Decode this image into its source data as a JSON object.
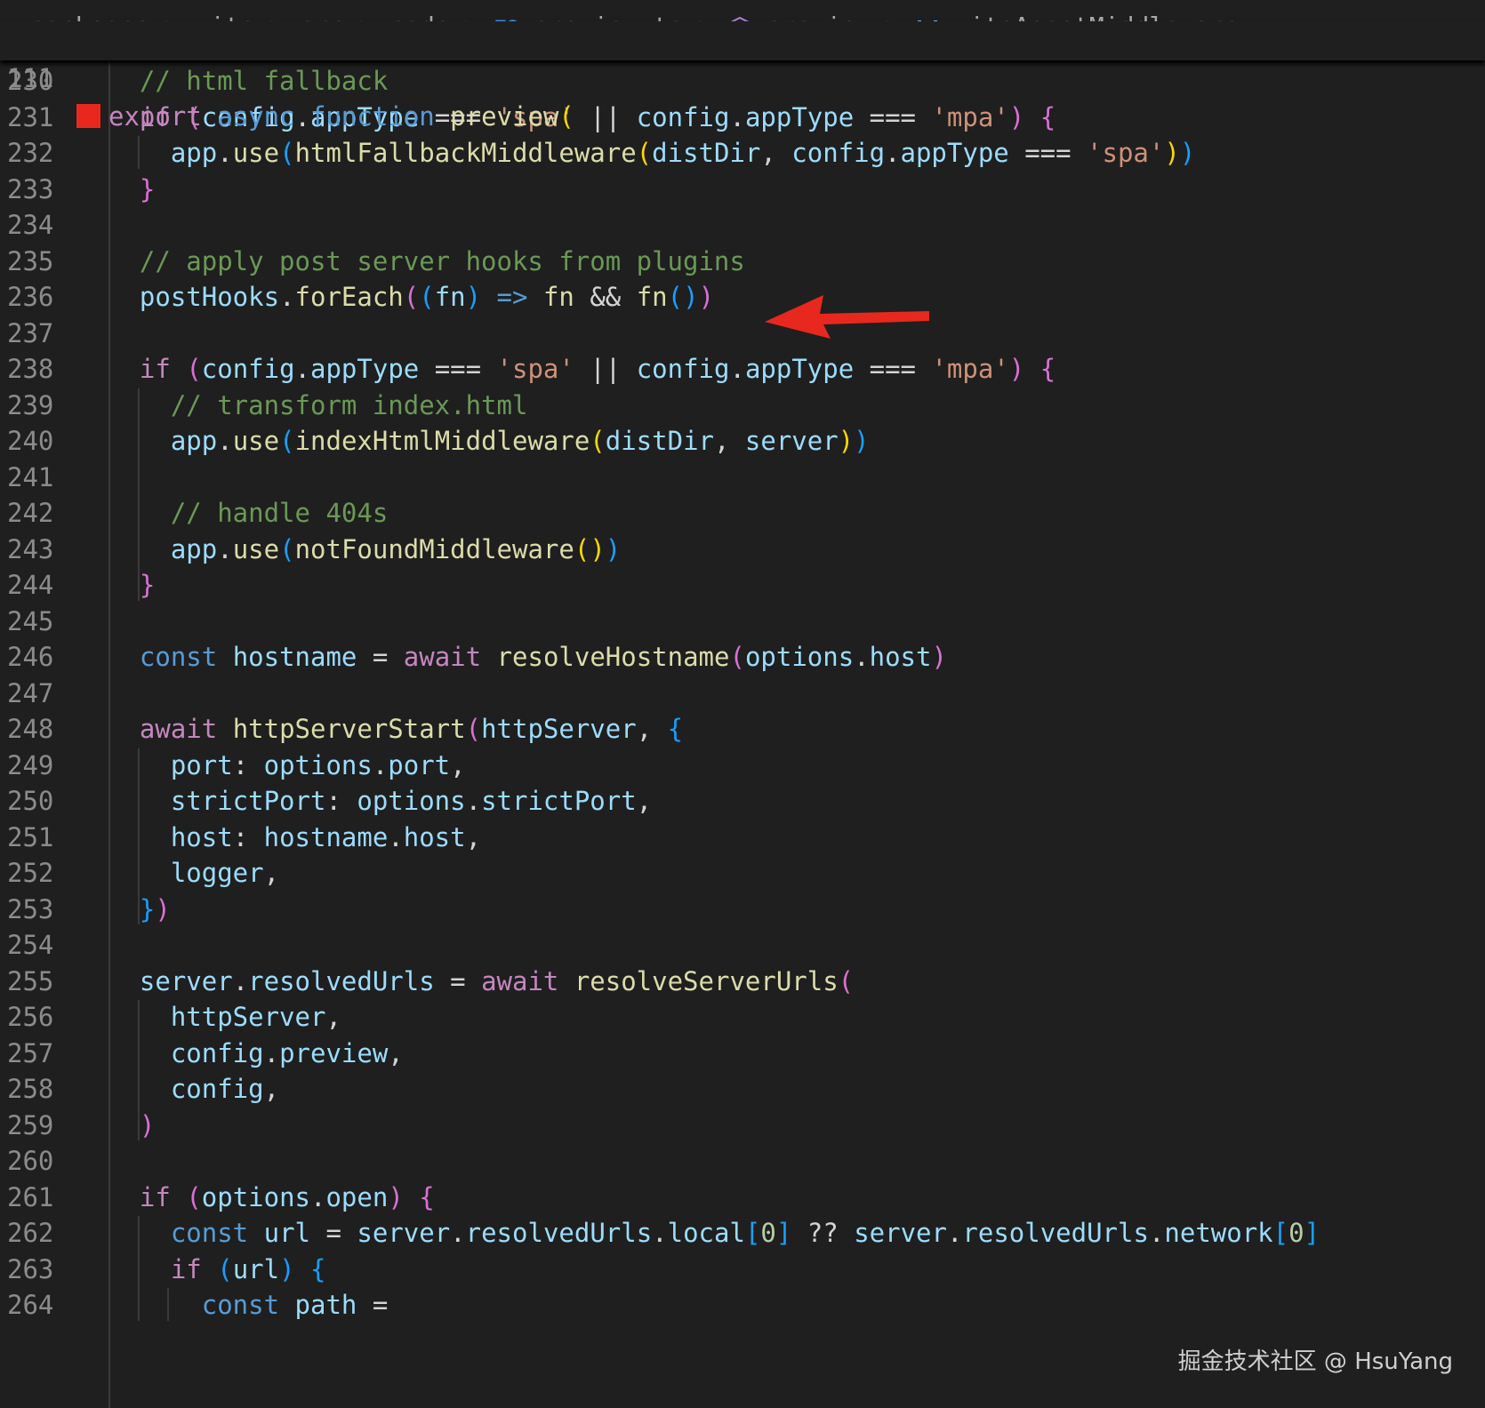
{
  "breadcrumb": {
    "items": [
      "packages",
      "vite",
      "src",
      "node",
      "preview.ts",
      "preview",
      "viteAssetMiddleware"
    ],
    "file_badge": "TS",
    "separator": ">"
  },
  "sticky_header": {
    "line_number": "111",
    "tokens": [
      {
        "t": "export",
        "c": "c-kw"
      },
      {
        "t": " "
      },
      {
        "t": "async",
        "c": "c-blue"
      },
      {
        "t": " "
      },
      {
        "t": "function",
        "c": "c-blue"
      },
      {
        "t": " "
      },
      {
        "t": "preview",
        "c": "c-fn"
      },
      {
        "t": "(",
        "c": "b1"
      }
    ],
    "stop_indicator_color": "#e8281e"
  },
  "code_lines": [
    {
      "n": "230",
      "tokens": [
        {
          "t": "  "
        },
        {
          "t": "// html fallback",
          "c": "c-com"
        }
      ]
    },
    {
      "n": "231",
      "tokens": [
        {
          "t": "  "
        },
        {
          "t": "if",
          "c": "c-kw"
        },
        {
          "t": " "
        },
        {
          "t": "(",
          "c": "b2"
        },
        {
          "t": "config",
          "c": "c-var"
        },
        {
          "t": "."
        },
        {
          "t": "appType",
          "c": "c-var"
        },
        {
          "t": " === "
        },
        {
          "t": "'spa'",
          "c": "c-str"
        },
        {
          "t": " || "
        },
        {
          "t": "config",
          "c": "c-var"
        },
        {
          "t": "."
        },
        {
          "t": "appType",
          "c": "c-var"
        },
        {
          "t": " === "
        },
        {
          "t": "'mpa'",
          "c": "c-str"
        },
        {
          "t": ")",
          "c": "b2"
        },
        {
          "t": " "
        },
        {
          "t": "{",
          "c": "b2"
        }
      ]
    },
    {
      "n": "232",
      "tokens": [
        {
          "t": "    "
        },
        {
          "t": "app",
          "c": "c-var"
        },
        {
          "t": "."
        },
        {
          "t": "use",
          "c": "c-fn"
        },
        {
          "t": "(",
          "c": "b3"
        },
        {
          "t": "htmlFallbackMiddleware",
          "c": "c-fn"
        },
        {
          "t": "(",
          "c": "b1"
        },
        {
          "t": "distDir",
          "c": "c-var"
        },
        {
          "t": ", "
        },
        {
          "t": "config",
          "c": "c-var"
        },
        {
          "t": "."
        },
        {
          "t": "appType",
          "c": "c-var"
        },
        {
          "t": " === "
        },
        {
          "t": "'spa'",
          "c": "c-str"
        },
        {
          "t": ")",
          "c": "b1"
        },
        {
          "t": ")",
          "c": "b3"
        }
      ]
    },
    {
      "n": "233",
      "tokens": [
        {
          "t": "  "
        },
        {
          "t": "}",
          "c": "b2"
        }
      ]
    },
    {
      "n": "234",
      "tokens": []
    },
    {
      "n": "235",
      "tokens": [
        {
          "t": "  "
        },
        {
          "t": "// apply post server hooks from plugins",
          "c": "c-com"
        }
      ]
    },
    {
      "n": "236",
      "tokens": [
        {
          "t": "  "
        },
        {
          "t": "postHooks",
          "c": "c-var"
        },
        {
          "t": "."
        },
        {
          "t": "forEach",
          "c": "c-fn"
        },
        {
          "t": "(",
          "c": "b2"
        },
        {
          "t": "(",
          "c": "b3"
        },
        {
          "t": "fn",
          "c": "c-var"
        },
        {
          "t": ")",
          "c": "b3"
        },
        {
          "t": " "
        },
        {
          "t": "=>",
          "c": "c-blue"
        },
        {
          "t": " "
        },
        {
          "t": "fn",
          "c": "c-fn"
        },
        {
          "t": " && "
        },
        {
          "t": "fn",
          "c": "c-fn"
        },
        {
          "t": "(",
          "c": "b3"
        },
        {
          "t": ")",
          "c": "b3"
        },
        {
          "t": ")",
          "c": "b2"
        }
      ]
    },
    {
      "n": "237",
      "tokens": []
    },
    {
      "n": "238",
      "tokens": [
        {
          "t": "  "
        },
        {
          "t": "if",
          "c": "c-kw"
        },
        {
          "t": " "
        },
        {
          "t": "(",
          "c": "b2"
        },
        {
          "t": "config",
          "c": "c-var"
        },
        {
          "t": "."
        },
        {
          "t": "appType",
          "c": "c-var"
        },
        {
          "t": " === "
        },
        {
          "t": "'spa'",
          "c": "c-str"
        },
        {
          "t": " || "
        },
        {
          "t": "config",
          "c": "c-var"
        },
        {
          "t": "."
        },
        {
          "t": "appType",
          "c": "c-var"
        },
        {
          "t": " === "
        },
        {
          "t": "'mpa'",
          "c": "c-str"
        },
        {
          "t": ")",
          "c": "b2"
        },
        {
          "t": " "
        },
        {
          "t": "{",
          "c": "b2"
        }
      ]
    },
    {
      "n": "239",
      "tokens": [
        {
          "t": "    "
        },
        {
          "t": "// transform index.html",
          "c": "c-com"
        }
      ]
    },
    {
      "n": "240",
      "tokens": [
        {
          "t": "    "
        },
        {
          "t": "app",
          "c": "c-var"
        },
        {
          "t": "."
        },
        {
          "t": "use",
          "c": "c-fn"
        },
        {
          "t": "(",
          "c": "b3"
        },
        {
          "t": "indexHtmlMiddleware",
          "c": "c-fn"
        },
        {
          "t": "(",
          "c": "b1"
        },
        {
          "t": "distDir",
          "c": "c-var"
        },
        {
          "t": ", "
        },
        {
          "t": "server",
          "c": "c-var"
        },
        {
          "t": ")",
          "c": "b1"
        },
        {
          "t": ")",
          "c": "b3"
        }
      ]
    },
    {
      "n": "241",
      "tokens": []
    },
    {
      "n": "242",
      "tokens": [
        {
          "t": "    "
        },
        {
          "t": "// handle 404s",
          "c": "c-com"
        }
      ]
    },
    {
      "n": "243",
      "tokens": [
        {
          "t": "    "
        },
        {
          "t": "app",
          "c": "c-var"
        },
        {
          "t": "."
        },
        {
          "t": "use",
          "c": "c-fn"
        },
        {
          "t": "(",
          "c": "b3"
        },
        {
          "t": "notFoundMiddleware",
          "c": "c-fn"
        },
        {
          "t": "(",
          "c": "b1"
        },
        {
          "t": ")",
          "c": "b1"
        },
        {
          "t": ")",
          "c": "b3"
        }
      ]
    },
    {
      "n": "244",
      "tokens": [
        {
          "t": "  "
        },
        {
          "t": "}",
          "c": "b2"
        }
      ]
    },
    {
      "n": "245",
      "tokens": []
    },
    {
      "n": "246",
      "tokens": [
        {
          "t": "  "
        },
        {
          "t": "const",
          "c": "c-blue"
        },
        {
          "t": " "
        },
        {
          "t": "hostname",
          "c": "c-var"
        },
        {
          "t": " = "
        },
        {
          "t": "await",
          "c": "c-kw"
        },
        {
          "t": " "
        },
        {
          "t": "resolveHostname",
          "c": "c-fn"
        },
        {
          "t": "(",
          "c": "b2"
        },
        {
          "t": "options",
          "c": "c-var"
        },
        {
          "t": "."
        },
        {
          "t": "host",
          "c": "c-var"
        },
        {
          "t": ")",
          "c": "b2"
        }
      ]
    },
    {
      "n": "247",
      "tokens": []
    },
    {
      "n": "248",
      "tokens": [
        {
          "t": "  "
        },
        {
          "t": "await",
          "c": "c-kw"
        },
        {
          "t": " "
        },
        {
          "t": "httpServerStart",
          "c": "c-fn"
        },
        {
          "t": "(",
          "c": "b2"
        },
        {
          "t": "httpServer",
          "c": "c-var"
        },
        {
          "t": ", "
        },
        {
          "t": "{",
          "c": "b3"
        }
      ]
    },
    {
      "n": "249",
      "tokens": [
        {
          "t": "    "
        },
        {
          "t": "port",
          "c": "c-var"
        },
        {
          "t": ": "
        },
        {
          "t": "options",
          "c": "c-var"
        },
        {
          "t": "."
        },
        {
          "t": "port",
          "c": "c-var"
        },
        {
          "t": ","
        }
      ]
    },
    {
      "n": "250",
      "tokens": [
        {
          "t": "    "
        },
        {
          "t": "strictPort",
          "c": "c-var"
        },
        {
          "t": ": "
        },
        {
          "t": "options",
          "c": "c-var"
        },
        {
          "t": "."
        },
        {
          "t": "strictPort",
          "c": "c-var"
        },
        {
          "t": ","
        }
      ]
    },
    {
      "n": "251",
      "tokens": [
        {
          "t": "    "
        },
        {
          "t": "host",
          "c": "c-var"
        },
        {
          "t": ": "
        },
        {
          "t": "hostname",
          "c": "c-var"
        },
        {
          "t": "."
        },
        {
          "t": "host",
          "c": "c-var"
        },
        {
          "t": ","
        }
      ]
    },
    {
      "n": "252",
      "tokens": [
        {
          "t": "    "
        },
        {
          "t": "logger",
          "c": "c-var"
        },
        {
          "t": ","
        }
      ]
    },
    {
      "n": "253",
      "tokens": [
        {
          "t": "  "
        },
        {
          "t": "}",
          "c": "b3"
        },
        {
          "t": ")",
          "c": "b2"
        }
      ]
    },
    {
      "n": "254",
      "tokens": []
    },
    {
      "n": "255",
      "tokens": [
        {
          "t": "  "
        },
        {
          "t": "server",
          "c": "c-var"
        },
        {
          "t": "."
        },
        {
          "t": "resolvedUrls",
          "c": "c-var"
        },
        {
          "t": " = "
        },
        {
          "t": "await",
          "c": "c-kw"
        },
        {
          "t": " "
        },
        {
          "t": "resolveServerUrls",
          "c": "c-fn"
        },
        {
          "t": "(",
          "c": "b2"
        }
      ]
    },
    {
      "n": "256",
      "tokens": [
        {
          "t": "    "
        },
        {
          "t": "httpServer",
          "c": "c-var"
        },
        {
          "t": ","
        }
      ]
    },
    {
      "n": "257",
      "tokens": [
        {
          "t": "    "
        },
        {
          "t": "config",
          "c": "c-var"
        },
        {
          "t": "."
        },
        {
          "t": "preview",
          "c": "c-var"
        },
        {
          "t": ","
        }
      ]
    },
    {
      "n": "258",
      "tokens": [
        {
          "t": "    "
        },
        {
          "t": "config",
          "c": "c-var"
        },
        {
          "t": ","
        }
      ]
    },
    {
      "n": "259",
      "tokens": [
        {
          "t": "  "
        },
        {
          "t": ")",
          "c": "b2"
        }
      ]
    },
    {
      "n": "260",
      "tokens": []
    },
    {
      "n": "261",
      "tokens": [
        {
          "t": "  "
        },
        {
          "t": "if",
          "c": "c-kw"
        },
        {
          "t": " "
        },
        {
          "t": "(",
          "c": "b2"
        },
        {
          "t": "options",
          "c": "c-var"
        },
        {
          "t": "."
        },
        {
          "t": "open",
          "c": "c-var"
        },
        {
          "t": ")",
          "c": "b2"
        },
        {
          "t": " "
        },
        {
          "t": "{",
          "c": "b2"
        }
      ]
    },
    {
      "n": "262",
      "tokens": [
        {
          "t": "    "
        },
        {
          "t": "const",
          "c": "c-blue"
        },
        {
          "t": " "
        },
        {
          "t": "url",
          "c": "c-var"
        },
        {
          "t": " = "
        },
        {
          "t": "server",
          "c": "c-var"
        },
        {
          "t": "."
        },
        {
          "t": "resolvedUrls",
          "c": "c-var"
        },
        {
          "t": "."
        },
        {
          "t": "local",
          "c": "c-var"
        },
        {
          "t": "[",
          "c": "b3"
        },
        {
          "t": "0",
          "c": "c-num"
        },
        {
          "t": "]",
          "c": "b3"
        },
        {
          "t": " ?? "
        },
        {
          "t": "server",
          "c": "c-var"
        },
        {
          "t": "."
        },
        {
          "t": "resolvedUrls",
          "c": "c-var"
        },
        {
          "t": "."
        },
        {
          "t": "network",
          "c": "c-var"
        },
        {
          "t": "[",
          "c": "b3"
        },
        {
          "t": "0",
          "c": "c-num"
        },
        {
          "t": "]",
          "c": "b3"
        }
      ]
    },
    {
      "n": "263",
      "tokens": [
        {
          "t": "    "
        },
        {
          "t": "if",
          "c": "c-kw"
        },
        {
          "t": " "
        },
        {
          "t": "(",
          "c": "b3"
        },
        {
          "t": "url",
          "c": "c-var"
        },
        {
          "t": ")",
          "c": "b3"
        },
        {
          "t": " "
        },
        {
          "t": "{",
          "c": "b3"
        }
      ]
    },
    {
      "n": "264",
      "tokens": [
        {
          "t": "      "
        },
        {
          "t": "const",
          "c": "c-blue"
        },
        {
          "t": " "
        },
        {
          "t": "path",
          "c": "c-var"
        },
        {
          "t": " ="
        }
      ]
    }
  ],
  "annotation": {
    "arrow_color": "#e8281e",
    "points_to_line": "236"
  },
  "watermark": "掘金技术社区 @ HsuYang",
  "colors": {
    "background": "#1f1f1f",
    "keyword": "#c586c0",
    "storage": "#569cd6",
    "variable": "#9cdcfe",
    "function": "#dcdcaa",
    "string": "#ce9178",
    "comment": "#6a9955"
  }
}
